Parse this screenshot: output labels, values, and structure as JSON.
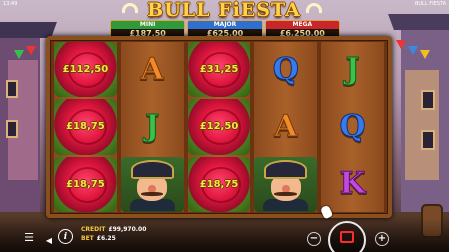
{
  "hud": {
    "time": "13:49",
    "game_name": "BULL FIESTA"
  },
  "logo": {
    "text": "BULL FiESTA"
  },
  "jackpots": [
    {
      "name": "MINI",
      "value": "£187,50",
      "color": "#2f9a3a"
    },
    {
      "name": "MAJOR",
      "value": "£625,00",
      "color": "#2f6fd0"
    },
    {
      "name": "MEGA",
      "value": "£6,250,00",
      "color": "#c8262a"
    }
  ],
  "reels": [
    [
      {
        "type": "rose",
        "value": "£112,50"
      },
      {
        "type": "rose",
        "value": "£18,75"
      },
      {
        "type": "rose",
        "value": "£18,75"
      }
    ],
    [
      {
        "type": "letter",
        "value": "A"
      },
      {
        "type": "letter",
        "value": "J"
      },
      {
        "type": "character",
        "icon": "matador-character-icon"
      }
    ],
    [
      {
        "type": "rose",
        "value": "£31,25"
      },
      {
        "type": "rose",
        "value": "£12,50"
      },
      {
        "type": "rose",
        "value": "£18,75"
      }
    ],
    [
      {
        "type": "letter",
        "value": "Q"
      },
      {
        "type": "letter",
        "value": "A"
      },
      {
        "type": "character",
        "icon": "matador-character-icon"
      }
    ],
    [
      {
        "type": "letter",
        "value": "J"
      },
      {
        "type": "letter",
        "value": "Q"
      },
      {
        "type": "letter",
        "value": "K"
      }
    ]
  ],
  "bottom_bar": {
    "credit_label": "CREDIT",
    "credit_value": "£99,970.00",
    "bet_label": "BET",
    "bet_value": "£6.25"
  },
  "colors": {
    "gold": "#ffd24a",
    "frame": "#8a4f1e",
    "spin_stop": "#ff2a2a",
    "letter_A": "#f08a2a",
    "letter_J": "#3cc24a",
    "letter_Q": "#3a7ae8",
    "letter_K": "#c24ae0"
  }
}
